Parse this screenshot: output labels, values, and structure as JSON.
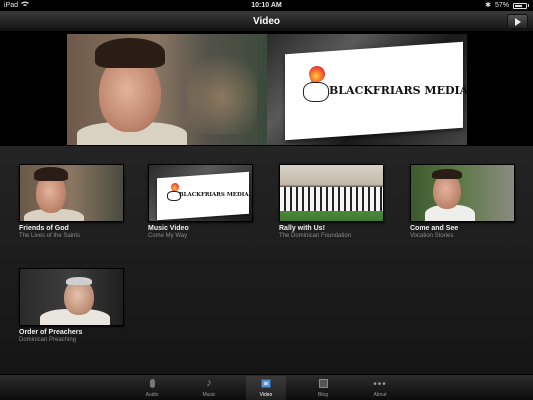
{
  "status_bar": {
    "device": "iPad",
    "wifi_icon": "wifi-icon",
    "time": "10:10 AM",
    "bluetooth": "✱",
    "battery": "57%",
    "battery_fraction": 0.57
  },
  "nav": {
    "title": "Video",
    "play_icon": "play-icon"
  },
  "hero": {
    "logo_text": "BLACKFRIARS MEDIA"
  },
  "videos": [
    {
      "title": "Friends of God",
      "subtitle": "The Lives of the Saints",
      "thumb": "man-portrait"
    },
    {
      "title": "Music Video",
      "subtitle": "Come My Way",
      "thumb": "blackfriars-logo",
      "logo_text": "BLACKFRIARS MEDIA"
    },
    {
      "title": "Rally with Us!",
      "subtitle": "The Dominican Foundation",
      "thumb": "group-photo"
    },
    {
      "title": "Come and See",
      "subtitle": "Vocation Stories",
      "thumb": "friar-portrait"
    },
    {
      "title": "Order of Preachers",
      "subtitle": "Dominican Preaching",
      "thumb": "elder-portrait"
    }
  ],
  "tabs": [
    {
      "label": "Audio",
      "icon": "microphone-icon",
      "active": false
    },
    {
      "label": "Music",
      "icon": "music-note-icon",
      "active": false
    },
    {
      "label": "Video",
      "icon": "film-icon",
      "active": true
    },
    {
      "label": "Blog",
      "icon": "blog-icon",
      "active": false
    },
    {
      "label": "About",
      "icon": "more-icon",
      "active": false
    }
  ],
  "colors": {
    "accent": "#5a92d6",
    "background": "#1c1c1c"
  }
}
